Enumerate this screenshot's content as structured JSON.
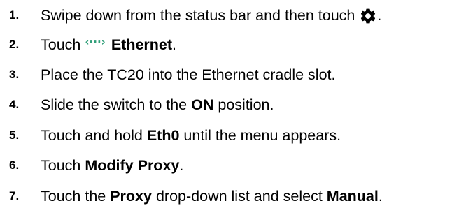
{
  "steps": [
    {
      "number": "1.",
      "text_before": "Swipe down from the status bar and then touch",
      "icon": "gear-icon",
      "text_after": "."
    },
    {
      "number": "2.",
      "text_before": "Touch",
      "icon": "ethernet-icon",
      "bold": "Ethernet",
      "text_after": "."
    },
    {
      "number": "3.",
      "text_before": "Place the TC20 into the Ethernet cradle slot."
    },
    {
      "number": "4.",
      "text_before": "Slide the switch to the",
      "bold": "ON",
      "text_after": "position."
    },
    {
      "number": "5.",
      "text_before": "Touch and hold",
      "bold": "Eth0",
      "text_after": "until the menu appears."
    },
    {
      "number": "6.",
      "text_before": "Touch",
      "bold": "Modify Proxy",
      "text_after": "."
    },
    {
      "number": "7.",
      "text_before": "Touch the",
      "bold": "Proxy",
      "text_middle": "drop-down list and select",
      "bold2": "Manual",
      "text_after": "."
    }
  ],
  "colors": {
    "text": "#000000",
    "ethernet_icon": "#2f9e78"
  }
}
